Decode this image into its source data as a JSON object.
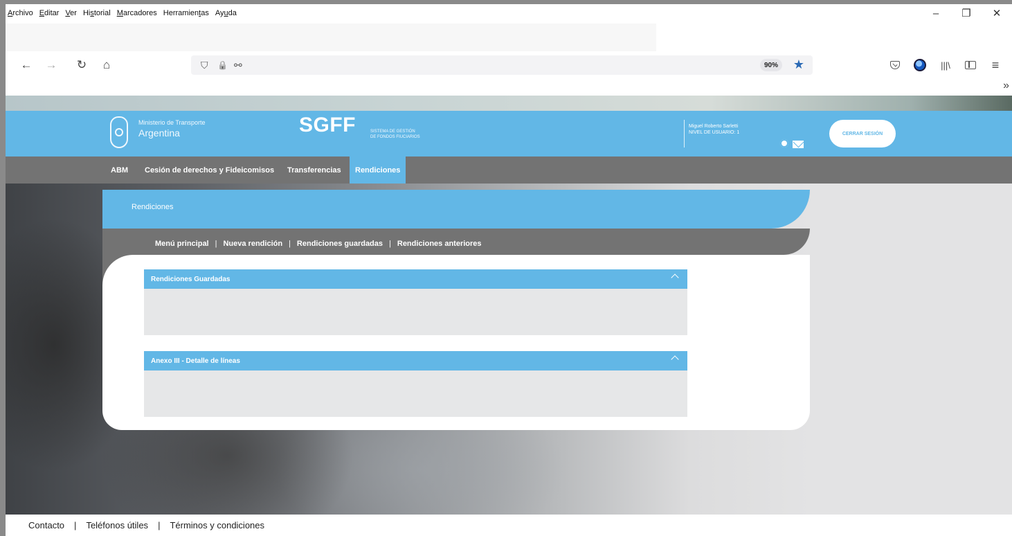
{
  "browser": {
    "menu": [
      {
        "mnemonic": "A",
        "rest": "rchivo"
      },
      {
        "mnemonic": "E",
        "rest": "ditar"
      },
      {
        "mnemonic": "V",
        "rest": "er"
      },
      {
        "pre": "Hi",
        "mnemonic": "s",
        "rest": "torial"
      },
      {
        "mnemonic": "M",
        "rest": "arcadores"
      },
      {
        "pre": "Herramien",
        "mnemonic": "t",
        "rest": "as"
      },
      {
        "pre": "Ay",
        "mnemonic": "u",
        "rest": "da"
      }
    ],
    "window_controls": {
      "minimize": "–",
      "maximize": "❐",
      "close": "✕"
    },
    "nav": {
      "back": "←",
      "forward": "→",
      "reload": "↻",
      "home": "⌂"
    },
    "url_icons": {
      "shield": "⛉",
      "lock": "🔒",
      "permissions": "⚯"
    },
    "zoom": "90%",
    "bookmark_star": "★",
    "toolbar_icons": [
      "pocket-icon",
      "profile-icon",
      "library-icon",
      "sidebar-icon",
      "menu-icon"
    ],
    "library_glyph": "|||\\",
    "menu_glyph": "≡",
    "overflow": "»"
  },
  "site": {
    "ministry_small": "Ministerio de Transporte",
    "ministry_big": "Argentina",
    "app_name": "SGFF",
    "app_sub_line1": "SISTEMA DE GESTIÓN",
    "app_sub_line2": "DE FONDOS FIUCIARIOS",
    "user_name": "Miguel Roberto Sarletti",
    "user_level": "NIVEL DE USUARIO: 1",
    "logout": "CERRAR SESIÓN",
    "nav": [
      {
        "label": "ABM",
        "active": false
      },
      {
        "label": "Cesión de derechos y Fideicomisos",
        "active": false
      },
      {
        "label": "Transferencias",
        "active": false
      },
      {
        "label": "Rendiciones",
        "active": true
      }
    ]
  },
  "content": {
    "section_title": "Rendiciones",
    "subnav": [
      "Menú principal",
      "Nueva rendición",
      "Rendiciones guardadas",
      "Rendiciones anteriores"
    ],
    "subnav_separator": "|",
    "panels": [
      {
        "title": "Rendiciones Guardadas"
      },
      {
        "title": "Anexo III - Detalle de líneas"
      }
    ]
  },
  "footer": {
    "links": [
      "Contacto",
      "Teléfonos útiles",
      "Términos y condiciones"
    ],
    "separator": "|"
  },
  "colors": {
    "accent_blue": "#62b7e6",
    "nav_gray": "#737373",
    "panel_body": "#e6e7e8"
  }
}
